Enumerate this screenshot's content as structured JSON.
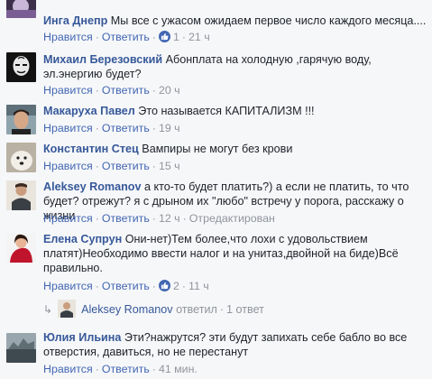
{
  "actions": {
    "like": "Нравится",
    "reply": "Ответить",
    "sep": "·",
    "edited": "Отредактирован"
  },
  "comments": [
    {
      "author": "Инга Днепр",
      "text": "Мы все с ужасом ожидаем первое число каждого месяца....",
      "likes": "1",
      "time": "21 ч"
    },
    {
      "author": "Михаил Березовский",
      "text": "Абонплата на холодную ,гарячую воду, эл.энергию будет?",
      "time": "20 ч"
    },
    {
      "author": "Макаруха Павел",
      "text": "Это называется КАПИТАЛИЗМ !!!",
      "time": "19 ч"
    },
    {
      "author": "Константин Стец",
      "text": "Вампиры не могут без крови",
      "time": "15 ч"
    },
    {
      "author": "Aleksey Romanov",
      "text": "а кто-то будет платить?) а если не платить, то что будет? отрежут? я с дрыном их \"любо\" встречу у порога, расскажу о жизни",
      "time": "12 ч"
    },
    {
      "author": "Елена Супрун",
      "text": "Они-нет)Тем более,что лохи с удовольствием платят)Необходимо ввести налог и на унитаз,двойной на биде)Всё правильно.",
      "likes": "2",
      "time": "11 ч"
    },
    {
      "author": "Юлия Ильина",
      "text": "Эти?нажрутся? эти будут запихать себе бабло во все отверстия, давиться, но не перестанут",
      "time": "41 мин."
    }
  ],
  "reply_summary": {
    "arrow": "↳",
    "name": "Aleksey Romanov",
    "verb": "ответил",
    "count": "1 ответ"
  },
  "icons": {
    "like_badge": "thumbs-up-icon",
    "reply": "reply-arrow-icon"
  },
  "colors": {
    "link": "#4267b2",
    "author": "#365899",
    "meta": "#90949c",
    "background": "#f6f7f9"
  }
}
